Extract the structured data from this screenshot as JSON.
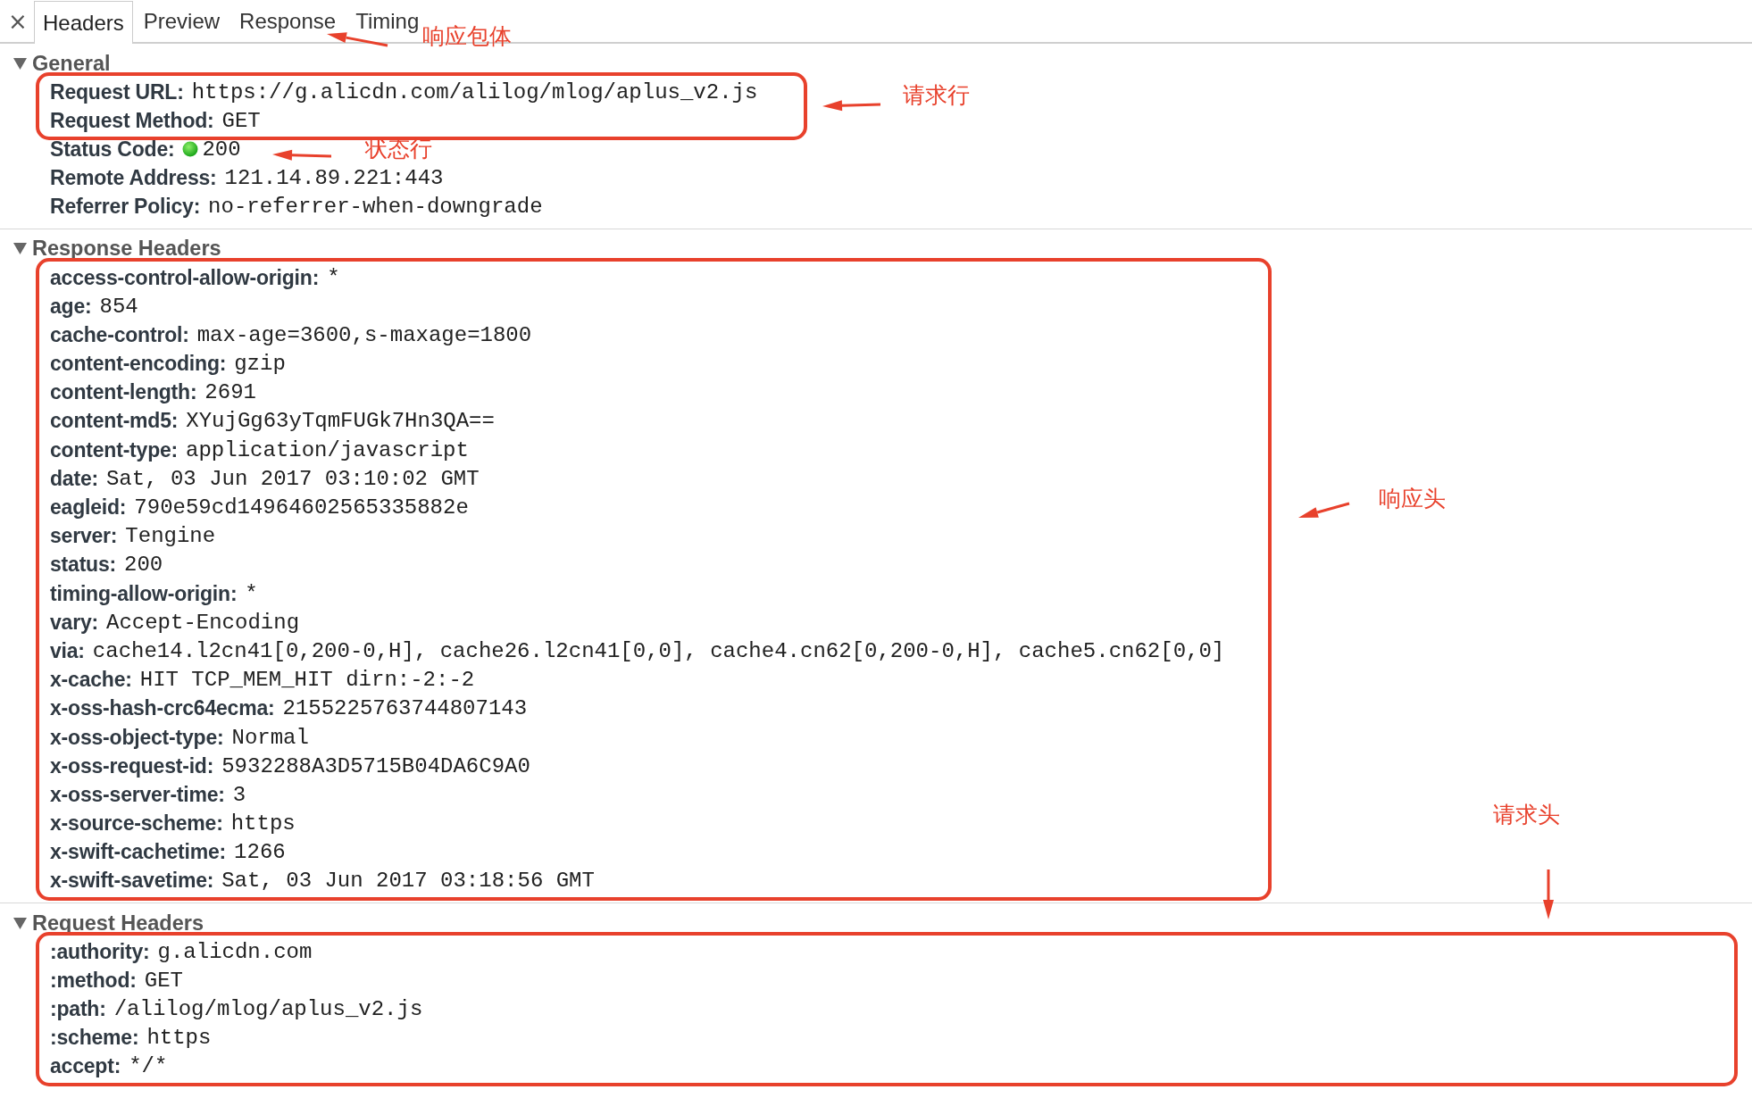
{
  "close": "×",
  "tabs": [
    {
      "label": "Headers",
      "selected": true
    },
    {
      "label": "Preview",
      "selected": false
    },
    {
      "label": "Response",
      "selected": false
    },
    {
      "label": "Timing",
      "selected": false
    }
  ],
  "sections": [
    {
      "title": "General",
      "expanded": true,
      "groups": [
        {
          "boxed": true,
          "rows": [
            {
              "kind": "plain",
              "name": "Request URL:",
              "value": "https://g.alicdn.com/alilog/mlog/aplus_v2.js"
            },
            {
              "kind": "plain",
              "name": "Request Method:",
              "value": "GET"
            }
          ]
        },
        {
          "boxed": false,
          "rows": [
            {
              "kind": "status",
              "name": "Status Code:",
              "value": "200"
            },
            {
              "kind": "plain",
              "name": "Remote Address:",
              "value": "121.14.89.221:443"
            },
            {
              "kind": "plain",
              "name": "Referrer Policy:",
              "value": "no-referrer-when-downgrade"
            }
          ]
        }
      ]
    },
    {
      "title": "Response Headers",
      "expanded": true,
      "groups": [
        {
          "boxed": true,
          "rows": [
            {
              "kind": "plain",
              "name": "access-control-allow-origin:",
              "value": "*"
            },
            {
              "kind": "plain",
              "name": "age:",
              "value": "854"
            },
            {
              "kind": "plain",
              "name": "cache-control:",
              "value": "max-age=3600,s-maxage=1800"
            },
            {
              "kind": "plain",
              "name": "content-encoding:",
              "value": "gzip"
            },
            {
              "kind": "plain",
              "name": "content-length:",
              "value": "2691"
            },
            {
              "kind": "plain",
              "name": "content-md5:",
              "value": "XYujGg63yTqmFUGk7Hn3QA=="
            },
            {
              "kind": "plain",
              "name": "content-type:",
              "value": "application/javascript"
            },
            {
              "kind": "plain",
              "name": "date:",
              "value": "Sat, 03 Jun 2017 03:10:02 GMT"
            },
            {
              "kind": "plain",
              "name": "eagleid:",
              "value": "790e59cd14964602565335882e"
            },
            {
              "kind": "plain",
              "name": "server:",
              "value": "Tengine"
            },
            {
              "kind": "plain",
              "name": "status:",
              "value": "200"
            },
            {
              "kind": "plain",
              "name": "timing-allow-origin:",
              "value": "*"
            },
            {
              "kind": "plain",
              "name": "vary:",
              "value": "Accept-Encoding"
            },
            {
              "kind": "plain",
              "name": "via:",
              "value": "cache14.l2cn41[0,200-0,H], cache26.l2cn41[0,0], cache4.cn62[0,200-0,H], cache5.cn62[0,0]"
            },
            {
              "kind": "plain",
              "name": "x-cache:",
              "value": "HIT TCP_MEM_HIT dirn:-2:-2"
            },
            {
              "kind": "plain",
              "name": "x-oss-hash-crc64ecma:",
              "value": "2155225763744807143"
            },
            {
              "kind": "plain",
              "name": "x-oss-object-type:",
              "value": "Normal"
            },
            {
              "kind": "plain",
              "name": "x-oss-request-id:",
              "value": "5932288A3D5715B04DA6C9A0"
            },
            {
              "kind": "plain",
              "name": "x-oss-server-time:",
              "value": "3"
            },
            {
              "kind": "plain",
              "name": "x-source-scheme:",
              "value": "https"
            },
            {
              "kind": "plain",
              "name": "x-swift-cachetime:",
              "value": "1266"
            },
            {
              "kind": "plain",
              "name": "x-swift-savetime:",
              "value": "Sat, 03 Jun 2017 03:18:56 GMT"
            }
          ]
        }
      ]
    },
    {
      "title": "Request Headers",
      "expanded": true,
      "groups": [
        {
          "boxed": true,
          "rows": [
            {
              "kind": "plain",
              "name": ":authority:",
              "value": "g.alicdn.com"
            },
            {
              "kind": "plain",
              "name": ":method:",
              "value": "GET"
            },
            {
              "kind": "plain",
              "name": ":path:",
              "value": "/alilog/mlog/aplus_v2.js"
            },
            {
              "kind": "plain",
              "name": ":scheme:",
              "value": "https"
            },
            {
              "kind": "plain",
              "name": "accept:",
              "value": "*/*"
            }
          ]
        }
      ]
    }
  ],
  "annotations": [
    {
      "text": "响应包体"
    },
    {
      "text": "请求行"
    },
    {
      "text": "状态行"
    },
    {
      "text": "响应头"
    },
    {
      "text": "请求头"
    }
  ]
}
